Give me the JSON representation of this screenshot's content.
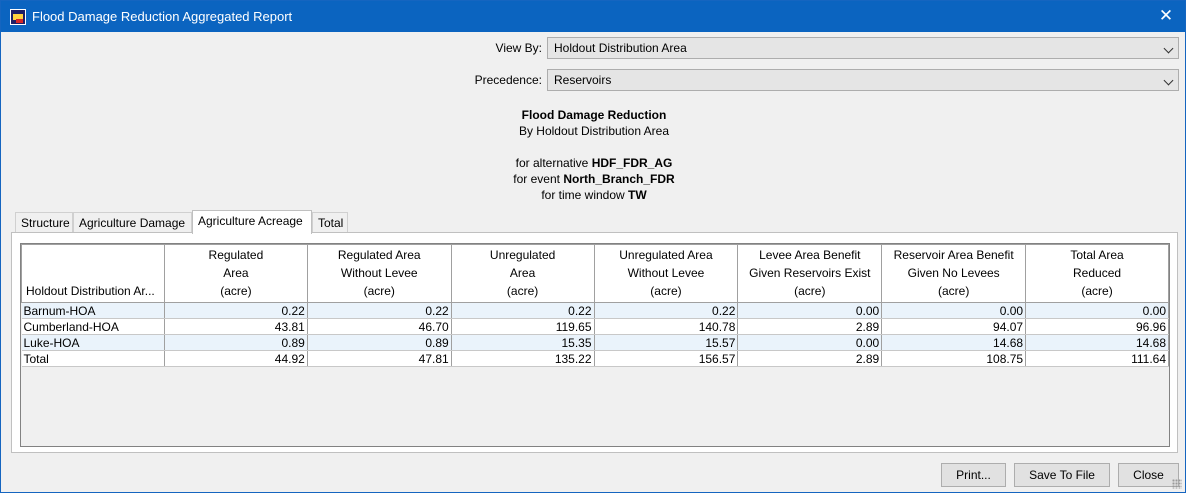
{
  "window": {
    "title": "Flood Damage Reduction Aggregated Report",
    "app_icon": "hec-fia-app-icon",
    "close_icon": "close-icon"
  },
  "filters": {
    "view_by": {
      "label": "View By:",
      "value": "Holdout Distribution Area"
    },
    "precedence": {
      "label": "Precedence:",
      "value": "Reservoirs"
    }
  },
  "report": {
    "title": "Flood Damage Reduction",
    "subtitle": "By Holdout Distribution Area",
    "alternative_prefix": "for alternative ",
    "alternative": "HDF_FDR_AG",
    "event_prefix": "for event ",
    "event": "North_Branch_FDR",
    "time_window_prefix": "for time window ",
    "time_window": "TW"
  },
  "tabs": [
    {
      "label": "Structure",
      "active": false
    },
    {
      "label": "Agriculture Damage",
      "active": false
    },
    {
      "label": "Agriculture Acreage",
      "active": true
    },
    {
      "label": "Total",
      "active": false
    }
  ],
  "table": {
    "columns": [
      {
        "lines": [
          "Holdout Distribution Ar..."
        ]
      },
      {
        "lines": [
          "Regulated",
          "Area",
          "(acre)"
        ]
      },
      {
        "lines": [
          "Regulated Area",
          "Without Levee",
          "(acre)"
        ]
      },
      {
        "lines": [
          "Unregulated",
          "Area",
          "(acre)"
        ]
      },
      {
        "lines": [
          "Unregulated Area",
          "Without Levee",
          "(acre)"
        ]
      },
      {
        "lines": [
          "Levee Area Benefit",
          "Given Reservoirs Exist",
          "(acre)"
        ]
      },
      {
        "lines": [
          "Reservoir Area Benefit",
          "Given No Levees",
          "(acre)"
        ]
      },
      {
        "lines": [
          "Total Area",
          "Reduced",
          "(acre)"
        ]
      }
    ],
    "rows": [
      [
        "Barnum-HOA",
        "0.22",
        "0.22",
        "0.22",
        "0.22",
        "0.00",
        "0.00",
        "0.00"
      ],
      [
        "Cumberland-HOA",
        "43.81",
        "46.70",
        "119.65",
        "140.78",
        "2.89",
        "94.07",
        "96.96"
      ],
      [
        "Luke-HOA",
        "0.89",
        "0.89",
        "15.35",
        "15.57",
        "0.00",
        "14.68",
        "14.68"
      ],
      [
        "Total",
        "44.92",
        "47.81",
        "135.22",
        "156.57",
        "2.89",
        "108.75",
        "111.64"
      ]
    ]
  },
  "buttons": {
    "print": "Print...",
    "save": "Save To File",
    "close": "Close"
  },
  "colors": {
    "titlebar": "#0b64c0",
    "row_highlight": "#eaf3fb"
  }
}
